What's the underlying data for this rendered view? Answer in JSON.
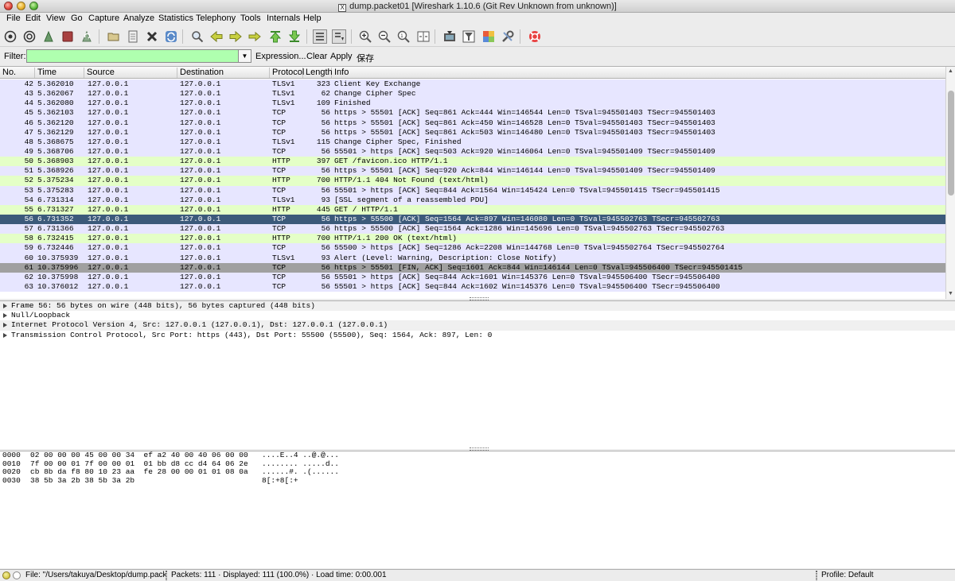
{
  "window": {
    "title": "dump.packet01  [Wireshark 1.10.6  (Git Rev Unknown from unknown)]"
  },
  "menu": [
    "File",
    "Edit",
    "View",
    "Go",
    "Capture",
    "Analyze",
    "Statistics",
    "Telephony",
    "Tools",
    "Internals",
    "Help"
  ],
  "toolbar_icons": [
    "interface-list-icon",
    "capture-options-icon",
    "start-capture-icon",
    "stop-capture-icon",
    "restart-capture-icon",
    "open-file-icon",
    "save-file-icon",
    "close-file-icon",
    "reload-icon",
    "find-packet-icon",
    "go-back-icon",
    "go-forward-icon",
    "go-to-packet-icon",
    "first-packet-icon",
    "last-packet-icon",
    "colorize-icon",
    "auto-scroll-icon",
    "zoom-in-icon",
    "zoom-out-icon",
    "normal-size-icon",
    "resize-columns-icon",
    "capture-filters-icon",
    "display-filters-icon",
    "coloring-rules-icon",
    "preferences-icon",
    "help-icon"
  ],
  "filter": {
    "label": "Filter:",
    "value": "",
    "expression": "Expression...",
    "clear": "Clear",
    "apply": "Apply",
    "save": "保存"
  },
  "packet_list": {
    "columns": [
      "No.",
      "Time",
      "Source",
      "Destination",
      "Protocol",
      "Length",
      "Info"
    ],
    "rows": [
      {
        "no": "42",
        "time": "5.362010",
        "src": "127.0.0.1",
        "dst": "127.0.0.1",
        "proto": "TLSv1",
        "len": "323",
        "info": "Client Key Exchange",
        "color": "#e7e6ff"
      },
      {
        "no": "43",
        "time": "5.362067",
        "src": "127.0.0.1",
        "dst": "127.0.0.1",
        "proto": "TLSv1",
        "len": "62",
        "info": "Change Cipher Spec",
        "color": "#e7e6ff"
      },
      {
        "no": "44",
        "time": "5.362080",
        "src": "127.0.0.1",
        "dst": "127.0.0.1",
        "proto": "TLSv1",
        "len": "109",
        "info": "Finished",
        "color": "#e7e6ff"
      },
      {
        "no": "45",
        "time": "5.362103",
        "src": "127.0.0.1",
        "dst": "127.0.0.1",
        "proto": "TCP",
        "len": "56",
        "info": "https > 55501 [ACK] Seq=861 Ack=444 Win=146544 Len=0 TSval=945501403 TSecr=945501403",
        "color": "#e7e6ff"
      },
      {
        "no": "46",
        "time": "5.362120",
        "src": "127.0.0.1",
        "dst": "127.0.0.1",
        "proto": "TCP",
        "len": "56",
        "info": "https > 55501 [ACK] Seq=861 Ack=450 Win=146528 Len=0 TSval=945501403 TSecr=945501403",
        "color": "#e7e6ff"
      },
      {
        "no": "47",
        "time": "5.362129",
        "src": "127.0.0.1",
        "dst": "127.0.0.1",
        "proto": "TCP",
        "len": "56",
        "info": "https > 55501 [ACK] Seq=861 Ack=503 Win=146480 Len=0 TSval=945501403 TSecr=945501403",
        "color": "#e7e6ff"
      },
      {
        "no": "48",
        "time": "5.368675",
        "src": "127.0.0.1",
        "dst": "127.0.0.1",
        "proto": "TLSv1",
        "len": "115",
        "info": "Change Cipher Spec, Finished",
        "color": "#e7e6ff"
      },
      {
        "no": "49",
        "time": "5.368706",
        "src": "127.0.0.1",
        "dst": "127.0.0.1",
        "proto": "TCP",
        "len": "56",
        "info": "55501 > https [ACK] Seq=503 Ack=920 Win=146064 Len=0 TSval=945501409 TSecr=945501409",
        "color": "#e7e6ff"
      },
      {
        "no": "50",
        "time": "5.368903",
        "src": "127.0.0.1",
        "dst": "127.0.0.1",
        "proto": "HTTP",
        "len": "397",
        "info": "GET /favicon.ico HTTP/1.1",
        "color": "#e4ffc7"
      },
      {
        "no": "51",
        "time": "5.368926",
        "src": "127.0.0.1",
        "dst": "127.0.0.1",
        "proto": "TCP",
        "len": "56",
        "info": "https > 55501 [ACK] Seq=920 Ack=844 Win=146144 Len=0 TSval=945501409 TSecr=945501409",
        "color": "#e7e6ff"
      },
      {
        "no": "52",
        "time": "5.375234",
        "src": "127.0.0.1",
        "dst": "127.0.0.1",
        "proto": "HTTP",
        "len": "700",
        "info": "HTTP/1.1 404 Not Found  (text/html)",
        "color": "#e4ffc7"
      },
      {
        "no": "53",
        "time": "5.375283",
        "src": "127.0.0.1",
        "dst": "127.0.0.1",
        "proto": "TCP",
        "len": "56",
        "info": "55501 > https [ACK] Seq=844 Ack=1564 Win=145424 Len=0 TSval=945501415 TSecr=945501415",
        "color": "#e7e6ff"
      },
      {
        "no": "54",
        "time": "6.731314",
        "src": "127.0.0.1",
        "dst": "127.0.0.1",
        "proto": "TLSv1",
        "len": "93",
        "info": "[SSL segment of a reassembled PDU]",
        "color": "#e7e6ff"
      },
      {
        "no": "55",
        "time": "6.731327",
        "src": "127.0.0.1",
        "dst": "127.0.0.1",
        "proto": "HTTP",
        "len": "445",
        "info": "GET / HTTP/1.1",
        "color": "#e4ffc7"
      },
      {
        "no": "56",
        "time": "6.731352",
        "src": "127.0.0.1",
        "dst": "127.0.0.1",
        "proto": "TCP",
        "len": "56",
        "info": "https > 55500 [ACK] Seq=1564 Ack=897 Win=146080 Len=0 TSval=945502763 TSecr=945502763",
        "color": "#3c5a7a",
        "selected": true
      },
      {
        "no": "57",
        "time": "6.731366",
        "src": "127.0.0.1",
        "dst": "127.0.0.1",
        "proto": "TCP",
        "len": "56",
        "info": "https > 55500 [ACK] Seq=1564 Ack=1286 Win=145696 Len=0 TSval=945502763 TSecr=945502763",
        "color": "#e7e6ff"
      },
      {
        "no": "58",
        "time": "6.732415",
        "src": "127.0.0.1",
        "dst": "127.0.0.1",
        "proto": "HTTP",
        "len": "700",
        "info": "HTTP/1.1 200 OK  (text/html)",
        "color": "#e4ffc7"
      },
      {
        "no": "59",
        "time": "6.732446",
        "src": "127.0.0.1",
        "dst": "127.0.0.1",
        "proto": "TCP",
        "len": "56",
        "info": "55500 > https [ACK] Seq=1286 Ack=2208 Win=144768 Len=0 TSval=945502764 TSecr=945502764",
        "color": "#e7e6ff"
      },
      {
        "no": "60",
        "time": "10.375939",
        "src": "127.0.0.1",
        "dst": "127.0.0.1",
        "proto": "TLSv1",
        "len": "93",
        "info": "Alert (Level: Warning, Description: Close Notify)",
        "color": "#e7e6ff"
      },
      {
        "no": "61",
        "time": "10.375996",
        "src": "127.0.0.1",
        "dst": "127.0.0.1",
        "proto": "TCP",
        "len": "56",
        "info": "https > 55501 [FIN, ACK] Seq=1601 Ack=844 Win=146144 Len=0 TSval=945506400 TSecr=945501415",
        "color": "#a0a0a0"
      },
      {
        "no": "62",
        "time": "10.375998",
        "src": "127.0.0.1",
        "dst": "127.0.0.1",
        "proto": "TCP",
        "len": "56",
        "info": "55501 > https [ACK] Seq=844 Ack=1601 Win=145376 Len=0 TSval=945506400 TSecr=945506400",
        "color": "#e7e6ff"
      },
      {
        "no": "63",
        "time": "10.376012",
        "src": "127.0.0.1",
        "dst": "127.0.0.1",
        "proto": "TCP",
        "len": "56",
        "info": "55501 > https [ACK] Seq=844 Ack=1602 Win=145376 Len=0 TSval=945506400 TSecr=945506400",
        "color": "#e7e6ff"
      }
    ]
  },
  "details": [
    "Frame 56: 56 bytes on wire (448 bits), 56 bytes captured (448 bits)",
    "Null/Loopback",
    "Internet Protocol Version 4, Src: 127.0.0.1 (127.0.0.1), Dst: 127.0.0.1 (127.0.0.1)",
    "Transmission Control Protocol, Src Port: https (443), Dst Port: 55500 (55500), Seq: 1564, Ack: 897, Len: 0"
  ],
  "bytes": [
    {
      "offset": "0000",
      "hex": "02 00 00 00 45 00 00 34  ef a2 40 00 40 06 00 00",
      "ascii": "....E..4 ..@.@..."
    },
    {
      "offset": "0010",
      "hex": "7f 00 00 01 7f 00 00 01  01 bb d8 cc d4 64 06 2e",
      "ascii": "........ .....d.."
    },
    {
      "offset": "0020",
      "hex": "cb 8b da f8 80 10 23 aa  fe 28 00 00 01 01 08 0a",
      "ascii": "......#. .(......"
    },
    {
      "offset": "0030",
      "hex": "38 5b 3a 2b 38 5b 3a 2b",
      "ascii": "8[:+8[:+"
    }
  ],
  "status": {
    "file": "File: \"/Users/takuya/Desktop/dump.packe",
    "packets": "Packets: 111 · Displayed: 111 (100.0%)  · Load time: 0:00.001",
    "profile": "Profile: Default"
  }
}
